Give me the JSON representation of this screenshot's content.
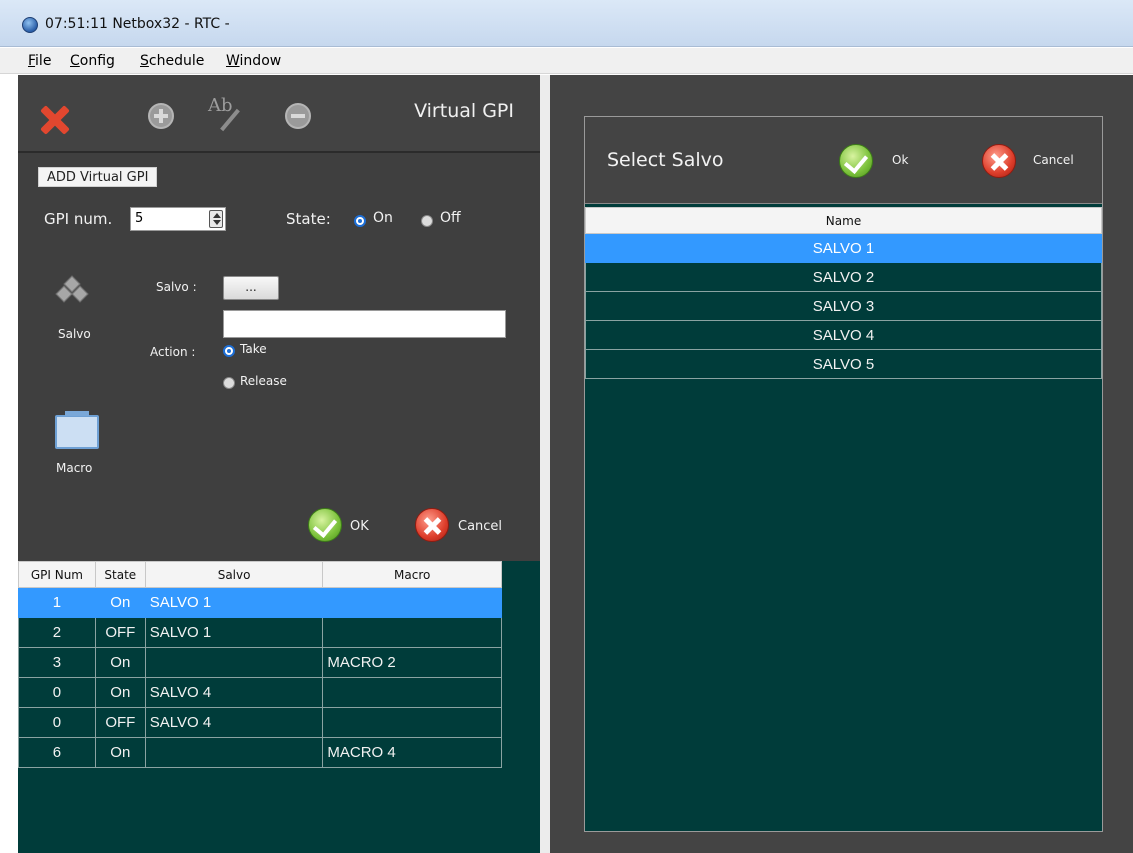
{
  "window": {
    "title": "07:51:11  Netbox32 - RTC -"
  },
  "menu": {
    "items": [
      "File",
      "Config",
      "Schedule",
      "Window"
    ]
  },
  "left_panel": {
    "title": "Virtual GPI",
    "toolbar_icons": [
      "close-icon",
      "add-icon",
      "rename-icon",
      "remove-icon"
    ],
    "section_label": "ADD Virtual GPI",
    "gpi_num_label": "GPI num.",
    "gpi_num_value": "5",
    "state_label": "State:",
    "state_on_label": "On",
    "state_off_label": "Off",
    "state_selected": "On",
    "salvo_icon_label": "Salvo",
    "macro_icon_label": "Macro",
    "salvo_field_label": "Salvo :",
    "salvo_browse_label": "...",
    "salvo_field_value": "",
    "action_label": "Action :",
    "action_take_label": "Take",
    "action_release_label": "Release",
    "action_selected": "Take",
    "ok_label": "OK",
    "cancel_label": "Cancel"
  },
  "gpi_table": {
    "columns": [
      "GPI Num",
      "State",
      "Salvo",
      "Macro"
    ],
    "selected_row": 0,
    "rows": [
      {
        "num": "1",
        "state": "On",
        "salvo": "SALVO 1",
        "macro": ""
      },
      {
        "num": "2",
        "state": "OFF",
        "salvo": "SALVO 1",
        "macro": ""
      },
      {
        "num": "3",
        "state": "On",
        "salvo": "",
        "macro": "MACRO 2"
      },
      {
        "num": "0",
        "state": "On",
        "salvo": "SALVO 4",
        "macro": ""
      },
      {
        "num": "0",
        "state": "OFF",
        "salvo": "SALVO 4",
        "macro": ""
      },
      {
        "num": "6",
        "state": "On",
        "salvo": "",
        "macro": "MACRO 4"
      }
    ]
  },
  "select_salvo_dialog": {
    "title": "Select Salvo",
    "ok_label": "Ok",
    "cancel_label": "Cancel",
    "column": "Name",
    "selected_row": 0,
    "rows": [
      "SALVO 1",
      "SALVO 2",
      "SALVO 3",
      "SALVO 4",
      "SALVO 5"
    ]
  },
  "colors": {
    "panel_bg": "#3f3f3f",
    "table_bg": "#003c3a",
    "selection": "#3399ff",
    "ok_green": "#7bc13a",
    "cancel_red": "#dd3d2a"
  }
}
